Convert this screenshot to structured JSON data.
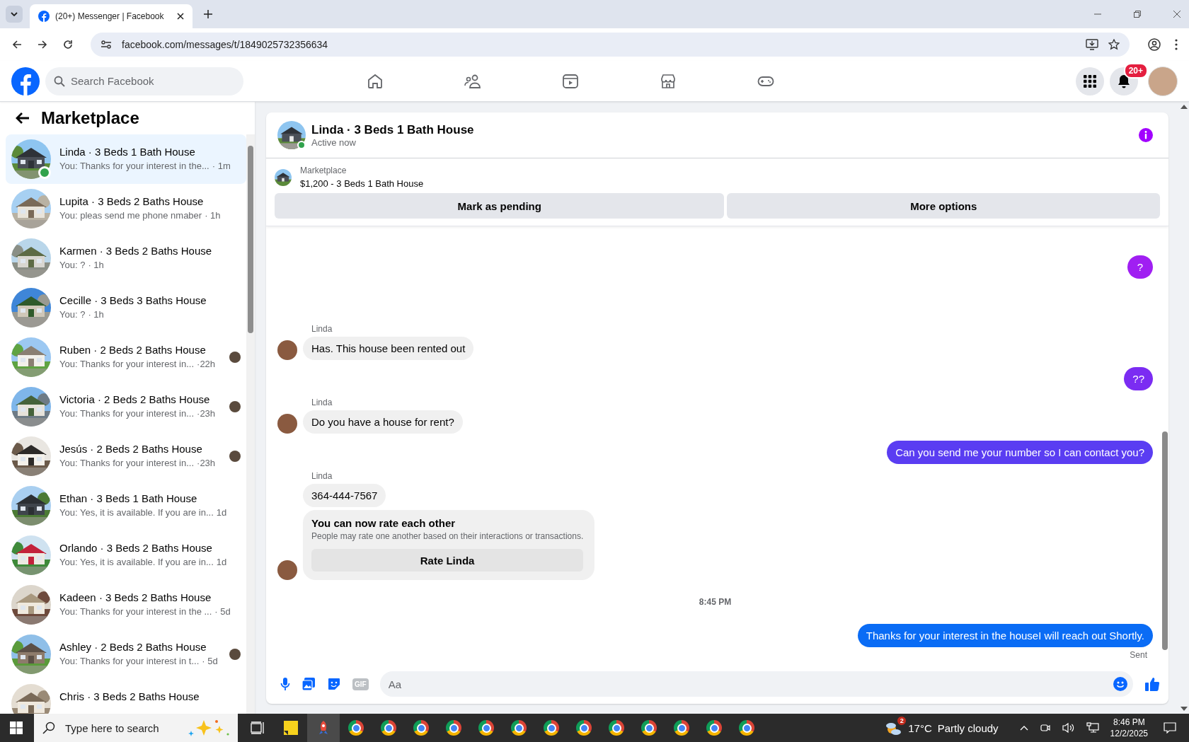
{
  "browser": {
    "tab_title": "(20+) Messenger | Facebook",
    "url": "facebook.com/messages/t/1849025732356634"
  },
  "header": {
    "search_placeholder": "Search Facebook",
    "notification_badge": "20+"
  },
  "sidebar": {
    "title": "Marketplace",
    "conversations": [
      {
        "title": "Linda · 3 Beds 1 Bath House",
        "preview": "You: Thanks for your interest in the...",
        "time": "· 1m",
        "selected": true,
        "online": true,
        "seen": false
      },
      {
        "title": "Lupita · 3 Beds 2 Baths House",
        "preview": "You: pleas send me phone nmaber",
        "time": "· 1h",
        "selected": false,
        "online": false,
        "seen": false
      },
      {
        "title": "Karmen · 3 Beds 2 Baths House",
        "preview": "You: ?",
        "time": "· 1h",
        "selected": false,
        "online": false,
        "seen": false
      },
      {
        "title": "Cecille · 3 Beds 3 Baths House",
        "preview": "You: ?",
        "time": "· 1h",
        "selected": false,
        "online": false,
        "seen": false
      },
      {
        "title": "Ruben · 2 Beds 2 Baths House",
        "preview": "You: Thanks for your interest in...",
        "time": "·22h",
        "selected": false,
        "online": false,
        "seen": true
      },
      {
        "title": "Victoria · 2 Beds 2 Baths House",
        "preview": "You: Thanks for your interest in...",
        "time": "·23h",
        "selected": false,
        "online": false,
        "seen": true
      },
      {
        "title": "Jesús · 2 Beds 2 Baths House",
        "preview": "You: Thanks for your interest in...",
        "time": "·23h",
        "selected": false,
        "online": false,
        "seen": true
      },
      {
        "title": "Ethan · 3 Beds 1 Bath House",
        "preview": "You: Yes, it is available. If you are in...",
        "time": "1d",
        "selected": false,
        "online": false,
        "seen": false
      },
      {
        "title": "Orlando · 3 Beds 2 Baths House",
        "preview": "You: Yes, it is available. If you are in...",
        "time": "1d",
        "selected": false,
        "online": false,
        "seen": false
      },
      {
        "title": "Kadeen · 3 Beds 2 Baths House",
        "preview": "You: Thanks for your interest in the ...",
        "time": "· 5d",
        "selected": false,
        "online": false,
        "seen": false
      },
      {
        "title": "Ashley · 2 Beds 2 Baths House",
        "preview": "You: Thanks for your interest in t...",
        "time": "· 5d",
        "selected": false,
        "online": false,
        "seen": true
      },
      {
        "title": "Chris · 3 Beds 2 Baths House",
        "selected": false,
        "online": false,
        "seen": false
      }
    ]
  },
  "chat": {
    "title": "Linda · 3 Beds 1 Bath House",
    "status": "Active now",
    "online": true,
    "listing": {
      "label": "Marketplace",
      "item": "$1,200 - 3 Beds 1 Bath House"
    },
    "actions": [
      "Mark as pending",
      "More options"
    ],
    "messages": [
      {
        "kind": "outgoing",
        "text": "?",
        "color": "#a01ff2"
      },
      {
        "kind": "incoming",
        "sender": "Linda",
        "text": "Has. This house been rented out",
        "avatar": true
      },
      {
        "kind": "outgoing",
        "text": "??",
        "color": "#7b2cf2"
      },
      {
        "kind": "incoming",
        "sender": "Linda",
        "text": "Do you have a house for rent?",
        "avatar": true
      },
      {
        "kind": "outgoing",
        "text": "Can you send me your number so I can contact you?",
        "color": "#5a3df2"
      },
      {
        "kind": "incoming",
        "sender": "Linda",
        "text": "364-444-7567",
        "avatar": false
      },
      {
        "kind": "rating",
        "title": "You can now rate each other",
        "text": "People may rate one another based on their interactions or transactions.",
        "button": "Rate Linda",
        "avatar": true
      },
      {
        "kind": "time",
        "text": "8:45 PM"
      },
      {
        "kind": "outgoing",
        "text": "Thanks for your interest in the houseI will reach out Shortly.",
        "color": "#0a6cf5",
        "status": "Sent"
      }
    ],
    "composer": {
      "gif": "GIF",
      "placeholder": "Aa"
    }
  },
  "taskbar": {
    "search_placeholder": "Type here to search",
    "weather_badge": "2",
    "temperature": "17°C",
    "weather": "Partly cloudy",
    "time": "8:46 PM",
    "date": "12/2/2025"
  }
}
